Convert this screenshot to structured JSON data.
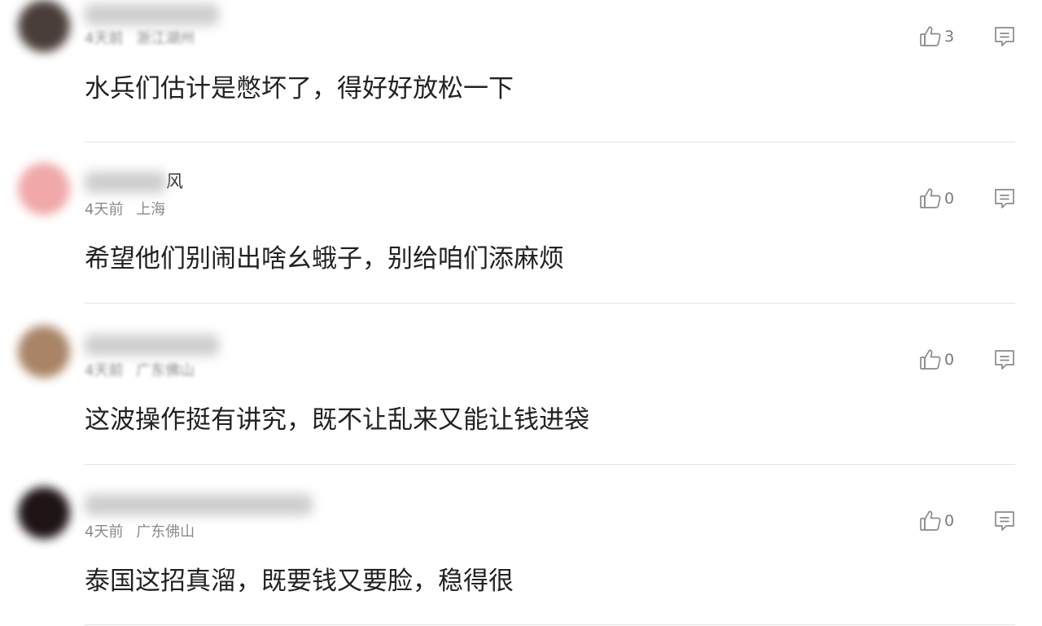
{
  "comments": [
    {
      "username_visible": "",
      "time": "4天前",
      "location": "浙江湖州",
      "text": "水兵们估计是憋坏了，得好好放松一下",
      "likes": "3",
      "avatar_color": "#4a3e3a",
      "meta_obscured": true
    },
    {
      "username_visible": "风",
      "time": "4天前",
      "location": "上海",
      "text": "希望他们别闹出啥幺蛾子，别给咱们添麻烦",
      "likes": "0",
      "avatar_color": "#f0a8a8",
      "meta_obscured": false
    },
    {
      "username_visible": "",
      "time": "4天前",
      "location": "广东佛山",
      "text": "这波操作挺有讲究，既不让乱来又能让钱进袋",
      "likes": "0",
      "avatar_color": "#a98466",
      "meta_obscured": true
    },
    {
      "username_visible": "",
      "time": "4天前",
      "location": "广东佛山",
      "text": "泰国这招真溜，既要钱又要脸，稳得很",
      "likes": "0",
      "avatar_color": "#1e1416",
      "meta_obscured": false
    }
  ],
  "icons": {
    "like": "thumbs-up-icon",
    "reply": "comment-icon"
  }
}
